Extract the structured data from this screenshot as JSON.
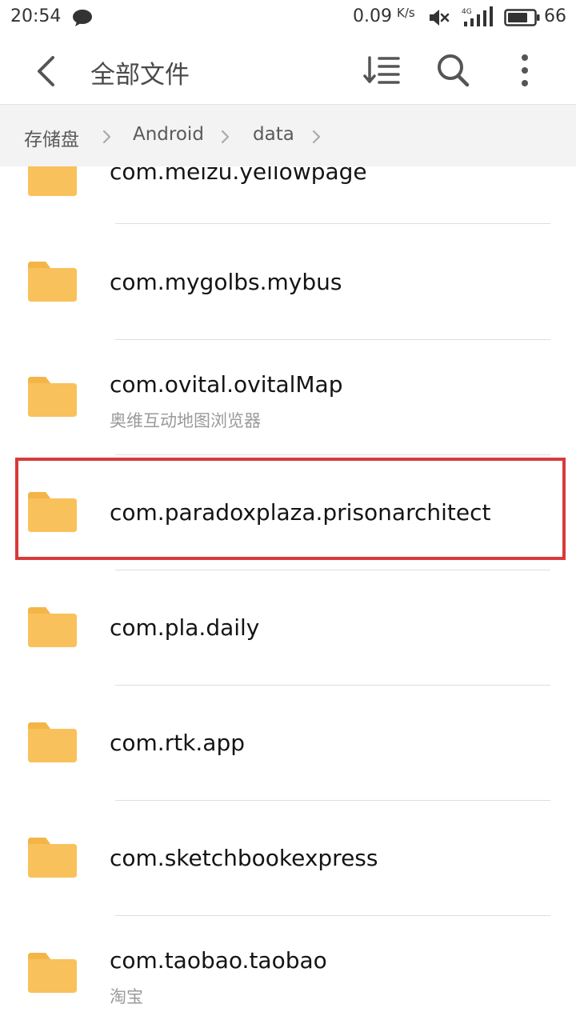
{
  "status_bar": {
    "time": "20:54",
    "net_speed": "0.09",
    "net_speed_unit": "K/s",
    "network": "4G",
    "battery": "66",
    "icons": [
      "chat-bubble-icon",
      "mute-icon",
      "signal-4g-icon",
      "battery-icon"
    ]
  },
  "app_bar": {
    "title": "全部文件",
    "icons": [
      "back-arrow-icon",
      "sort-icon",
      "search-icon",
      "more-vertical-icon"
    ]
  },
  "breadcrumb": {
    "items": [
      "存储盘",
      "Android",
      "data"
    ]
  },
  "files": [
    {
      "name": "com.meizu.yellowpage",
      "sub": ""
    },
    {
      "name": "com.mygolbs.mybus",
      "sub": ""
    },
    {
      "name": "com.ovital.ovitalMap",
      "sub": "奥维互动地图浏览器"
    },
    {
      "name": "com.paradoxplaza.prisonarchitect",
      "sub": ""
    },
    {
      "name": "com.pla.daily",
      "sub": ""
    },
    {
      "name": "com.rtk.app",
      "sub": ""
    },
    {
      "name": "com.sketchbookexpress",
      "sub": ""
    },
    {
      "name": "com.taobao.taobao",
      "sub": "淘宝"
    }
  ],
  "highlighted_index": 3,
  "colors": {
    "folder": "#f8c15b",
    "folder_tab": "#f4b548",
    "highlight": "#d83a3a",
    "breadcrumb_bg": "#f3f3f3"
  }
}
